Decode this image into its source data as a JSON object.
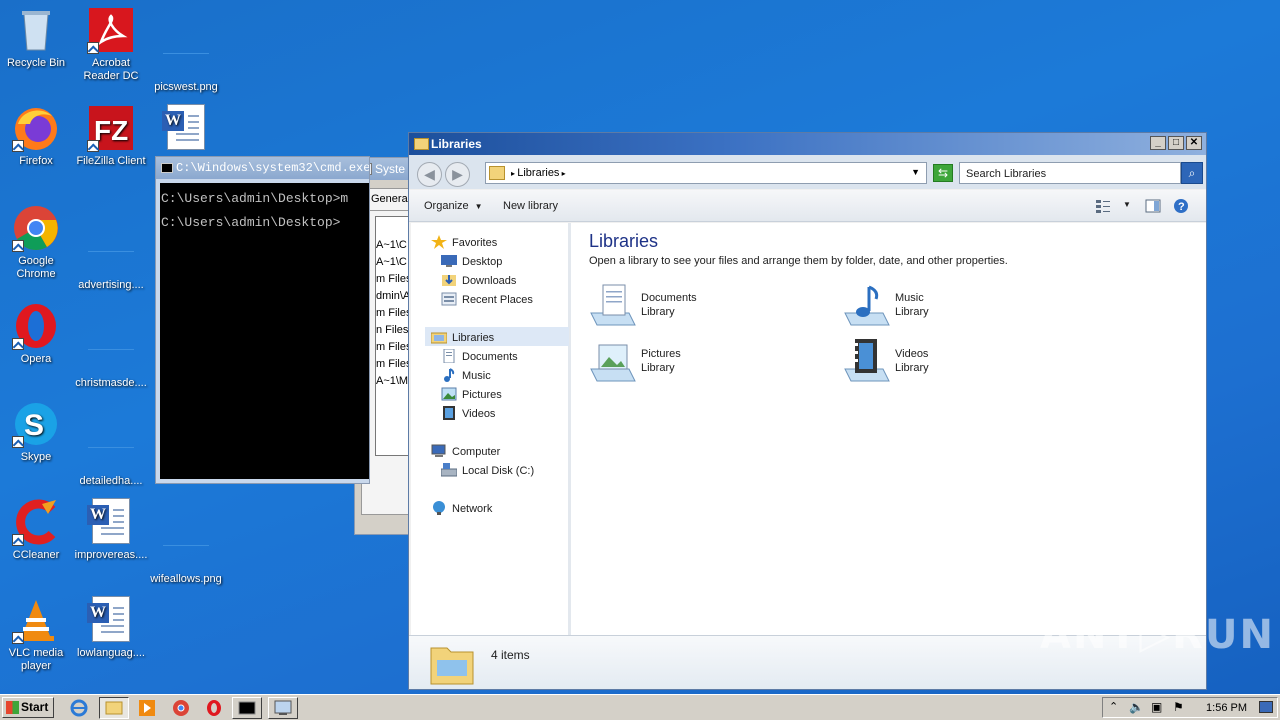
{
  "desktop": {
    "icons": [
      {
        "label": "Recycle Bin"
      },
      {
        "label": "Acrobat Reader DC"
      },
      {
        "label": "picswest.png"
      },
      {
        "label": "Firefox"
      },
      {
        "label": "FileZilla Client"
      },
      {
        "label": "Google Chrome"
      },
      {
        "label": "advertising...."
      },
      {
        "label": "Opera"
      },
      {
        "label": "christmasde...."
      },
      {
        "label": "Skype"
      },
      {
        "label": "detailedha...."
      },
      {
        "label": "CCleaner"
      },
      {
        "label": "improvereas...."
      },
      {
        "label": "wifeallows.png"
      },
      {
        "label": "VLC media player"
      },
      {
        "label": "lowlanguag...."
      }
    ]
  },
  "cmd": {
    "title": "C:\\Windows\\system32\\cmd.exe",
    "lines": [
      "C:\\Users\\admin\\Desktop>m",
      "C:\\Users\\admin\\Desktop>"
    ]
  },
  "sysprops": {
    "title": "Syste",
    "tab": "General",
    "list": [
      "A~1\\C",
      "A~1\\C",
      "m Files",
      "dmin\\A",
      "m Files",
      "n Files\\",
      "m Files",
      "m Files",
      "A~1\\M"
    ]
  },
  "explorer": {
    "title": "Libraries",
    "address": "Libraries",
    "search_placeholder": "Search Libraries",
    "toolbar": {
      "organize": "Organize",
      "new_library": "New library"
    },
    "nav": {
      "favorites": "Favorites",
      "desktop": "Desktop",
      "downloads": "Downloads",
      "recent": "Recent Places",
      "libraries": "Libraries",
      "documents": "Documents",
      "music": "Music",
      "pictures": "Pictures",
      "videos": "Videos",
      "computer": "Computer",
      "local_disk": "Local Disk (C:)",
      "network": "Network"
    },
    "heading": "Libraries",
    "subheading": "Open a library to see your files and arrange them by folder, date, and other properties.",
    "libraries": [
      {
        "name": "Documents",
        "type": "Library"
      },
      {
        "name": "Music",
        "type": "Library"
      },
      {
        "name": "Pictures",
        "type": "Library"
      },
      {
        "name": "Videos",
        "type": "Library"
      }
    ],
    "item_count": "4 items"
  },
  "taskbar": {
    "start": "Start",
    "clock": "1:56 PM"
  },
  "watermark": "ANY▷RUN"
}
